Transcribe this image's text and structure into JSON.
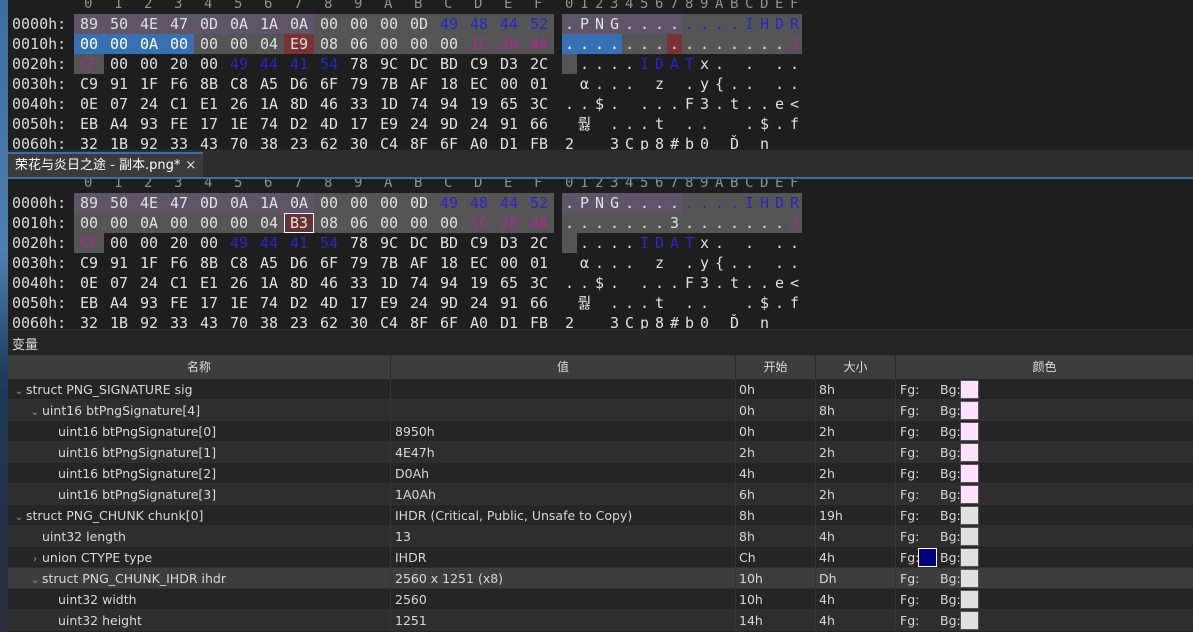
{
  "hex_header": [
    "0",
    "1",
    "2",
    "3",
    "4",
    "5",
    "6",
    "7",
    "8",
    "9",
    "A",
    "B",
    "C",
    "D",
    "E",
    "F"
  ],
  "hex_panel_top": {
    "rows": [
      {
        "addr": "0000h:",
        "bytes": [
          "89",
          "50",
          "4E",
          "47",
          "0D",
          "0A",
          "1A",
          "0A",
          "00",
          "00",
          "00",
          "0D",
          "49",
          "48",
          "44",
          "52"
        ],
        "ascii": [
          ".",
          "P",
          "N",
          "G",
          ".",
          ".",
          ".",
          ".",
          ".",
          ".",
          ".",
          ".",
          "I",
          "H",
          "D",
          "R"
        ]
      },
      {
        "addr": "0010h:",
        "bytes": [
          "00",
          "00",
          "0A",
          "00",
          "00",
          "00",
          "04",
          "E9",
          "08",
          "06",
          "00",
          "00",
          "00",
          "1C",
          "20",
          "4A"
        ],
        "ascii": [
          ".",
          ".",
          ".",
          ".",
          ".",
          ".",
          ".",
          ".",
          ".",
          ".",
          ".",
          ".",
          ".",
          ".",
          ".",
          "J"
        ]
      },
      {
        "addr": "0020h:",
        "bytes": [
          "CF",
          "00",
          "00",
          "20",
          "00",
          "49",
          "44",
          "41",
          "54",
          "78",
          "9C",
          "DC",
          "BD",
          "C9",
          "D3",
          "2C"
        ],
        "ascii": [
          "",
          ".",
          ".",
          ".",
          ".",
          "I",
          "D",
          "A",
          "T",
          "x",
          ".",
          "",
          ".",
          "",
          ".",
          "."
        ]
      },
      {
        "addr": "0030h:",
        "bytes": [
          "C9",
          "91",
          "1F",
          "F6",
          "8B",
          "C8",
          "A5",
          "D6",
          "6F",
          "79",
          "7B",
          "AF",
          "18",
          "EC",
          "00",
          "01"
        ],
        "ascii": [
          "",
          "α",
          ".",
          ".",
          ".",
          "",
          "z",
          "",
          ".",
          "y",
          "{",
          ".",
          ".",
          "",
          ".",
          "."
        ]
      },
      {
        "addr": "0040h:",
        "bytes": [
          "0E",
          "07",
          "24",
          "C1",
          "E1",
          "26",
          "1A",
          "8D",
          "46",
          "33",
          "1D",
          "74",
          "94",
          "19",
          "65",
          "3C"
        ],
        "ascii": [
          ".",
          ".",
          "$",
          ".",
          "",
          ".",
          ".",
          ".",
          "F",
          "3",
          ".",
          "t",
          ".",
          ".",
          "e",
          "<"
        ]
      },
      {
        "addr": "0050h:",
        "bytes": [
          "EB",
          "A4",
          "93",
          "FE",
          "17",
          "1E",
          "74",
          "D2",
          "4D",
          "17",
          "E9",
          "24",
          "9D",
          "24",
          "91",
          "66"
        ],
        "ascii": [
          "",
          "뤓",
          "",
          ".",
          ".",
          ".",
          "t",
          "",
          ".",
          ".",
          "",
          "",
          ".",
          "$",
          ".",
          "f"
        ]
      },
      {
        "addr": "0060h:",
        "bytes": [
          "32",
          "1B",
          "92",
          "33",
          "43",
          "70",
          "38",
          "23",
          "62",
          "30",
          "C4",
          "8F",
          "6F",
          "A0",
          "D1",
          "FB"
        ],
        "ascii": [
          "2",
          "",
          "",
          "3",
          "C",
          "p",
          "8",
          "#",
          "b",
          "0",
          "",
          "Ď",
          "",
          "n",
          "",
          ""
        ]
      }
    ]
  },
  "hex_panel_bottom": {
    "rows": [
      {
        "addr": "0000h:",
        "bytes": [
          "89",
          "50",
          "4E",
          "47",
          "0D",
          "0A",
          "1A",
          "0A",
          "00",
          "00",
          "00",
          "0D",
          "49",
          "48",
          "44",
          "52"
        ],
        "ascii": [
          ".",
          "P",
          "N",
          "G",
          ".",
          ".",
          ".",
          ".",
          ".",
          ".",
          ".",
          ".",
          "I",
          "H",
          "D",
          "R"
        ]
      },
      {
        "addr": "0010h:",
        "bytes": [
          "00",
          "00",
          "0A",
          "00",
          "00",
          "00",
          "04",
          "B3",
          "08",
          "06",
          "00",
          "00",
          "00",
          "1C",
          "20",
          "4A"
        ],
        "ascii": [
          ".",
          ".",
          ".",
          ".",
          ".",
          ".",
          ".",
          "3",
          ".",
          ".",
          ".",
          ".",
          ".",
          ".",
          ".",
          "J"
        ]
      },
      {
        "addr": "0020h:",
        "bytes": [
          "CF",
          "00",
          "00",
          "20",
          "00",
          "49",
          "44",
          "41",
          "54",
          "78",
          "9C",
          "DC",
          "BD",
          "C9",
          "D3",
          "2C"
        ],
        "ascii": [
          "",
          ".",
          ".",
          ".",
          ".",
          "I",
          "D",
          "A",
          "T",
          "x",
          ".",
          "",
          ".",
          "",
          ".",
          "."
        ]
      },
      {
        "addr": "0030h:",
        "bytes": [
          "C9",
          "91",
          "1F",
          "F6",
          "8B",
          "C8",
          "A5",
          "D6",
          "6F",
          "79",
          "7B",
          "AF",
          "18",
          "EC",
          "00",
          "01"
        ],
        "ascii": [
          "",
          "α",
          ".",
          ".",
          ".",
          "",
          "z",
          "",
          ".",
          "y",
          "{",
          ".",
          ".",
          "",
          ".",
          "."
        ]
      },
      {
        "addr": "0040h:",
        "bytes": [
          "0E",
          "07",
          "24",
          "C1",
          "E1",
          "26",
          "1A",
          "8D",
          "46",
          "33",
          "1D",
          "74",
          "94",
          "19",
          "65",
          "3C"
        ],
        "ascii": [
          ".",
          ".",
          "$",
          ".",
          "",
          ".",
          ".",
          ".",
          "F",
          "3",
          ".",
          "t",
          ".",
          ".",
          "e",
          "<"
        ]
      },
      {
        "addr": "0050h:",
        "bytes": [
          "EB",
          "A4",
          "93",
          "FE",
          "17",
          "1E",
          "74",
          "D2",
          "4D",
          "17",
          "E9",
          "24",
          "9D",
          "24",
          "91",
          "66"
        ],
        "ascii": [
          "",
          "뤓",
          "",
          ".",
          ".",
          ".",
          "t",
          "",
          ".",
          ".",
          "",
          "",
          ".",
          "$",
          ".",
          "f"
        ]
      },
      {
        "addr": "0060h:",
        "bytes": [
          "32",
          "1B",
          "92",
          "33",
          "43",
          "70",
          "38",
          "23",
          "62",
          "30",
          "C4",
          "8F",
          "6F",
          "A0",
          "D1",
          "FB"
        ],
        "ascii": [
          "2",
          "",
          "",
          "3",
          "C",
          "p",
          "8",
          "#",
          "b",
          "0",
          "",
          "Ď",
          "",
          "n",
          "",
          ""
        ]
      }
    ]
  },
  "tab": {
    "title": "荣花与炎日之途 - 副本.png*",
    "close": "×"
  },
  "variables": {
    "title": "变量",
    "columns": {
      "name": "名称",
      "value": "值",
      "start": "开始",
      "size": "大小",
      "color": "颜色"
    },
    "fg_label": "Fg:",
    "bg_label": "Bg:",
    "rows": [
      {
        "indent": 0,
        "chevron": "expanded",
        "name": "struct PNG_SIGNATURE sig",
        "value": "",
        "start": "0h",
        "size": "8h",
        "bg": "#ffe0ff"
      },
      {
        "indent": 1,
        "chevron": "expanded",
        "name": "uint16 btPngSignature[4]",
        "value": "",
        "start": "0h",
        "size": "8h",
        "bg": "#ffe0ff"
      },
      {
        "indent": 2,
        "chevron": "none",
        "name": "uint16 btPngSignature[0]",
        "value": "8950h",
        "start": "0h",
        "size": "2h",
        "bg": "#ffe0ff"
      },
      {
        "indent": 2,
        "chevron": "none",
        "name": "uint16 btPngSignature[1]",
        "value": "4E47h",
        "start": "2h",
        "size": "2h",
        "bg": "#ffe0ff"
      },
      {
        "indent": 2,
        "chevron": "none",
        "name": "uint16 btPngSignature[2]",
        "value": "D0Ah",
        "start": "4h",
        "size": "2h",
        "bg": "#ffe0ff"
      },
      {
        "indent": 2,
        "chevron": "none",
        "name": "uint16 btPngSignature[3]",
        "value": "1A0Ah",
        "start": "6h",
        "size": "2h",
        "bg": "#ffe0ff"
      },
      {
        "indent": 0,
        "chevron": "expanded",
        "name": "struct PNG_CHUNK chunk[0]",
        "value": "IHDR  (Critical, Public, Unsafe to Copy)",
        "start": "8h",
        "size": "19h",
        "bg": "#e0e0e0"
      },
      {
        "indent": 1,
        "chevron": "none",
        "name": "uint32 length",
        "value": "13",
        "start": "8h",
        "size": "4h",
        "bg": "#e0e0e0"
      },
      {
        "indent": 1,
        "chevron": "collapsed",
        "name": "union CTYPE type",
        "value": "IHDR",
        "start": "Ch",
        "size": "4h",
        "bg": "#e0e0e0",
        "fg": "#000080"
      },
      {
        "indent": 1,
        "chevron": "expanded",
        "name": "struct PNG_CHUNK_IHDR ihdr",
        "value": "2560 x 1251 (x8)",
        "start": "10h",
        "size": "Dh",
        "bg": "#e0e0e0",
        "selected": true
      },
      {
        "indent": 2,
        "chevron": "none",
        "name": "uint32 width",
        "value": "2560",
        "start": "10h",
        "size": "4h",
        "bg": "#e0e0e0"
      },
      {
        "indent": 2,
        "chevron": "none",
        "name": "uint32 height",
        "value": "1251",
        "start": "14h",
        "size": "4h",
        "bg": "#e0e0e0"
      }
    ]
  }
}
